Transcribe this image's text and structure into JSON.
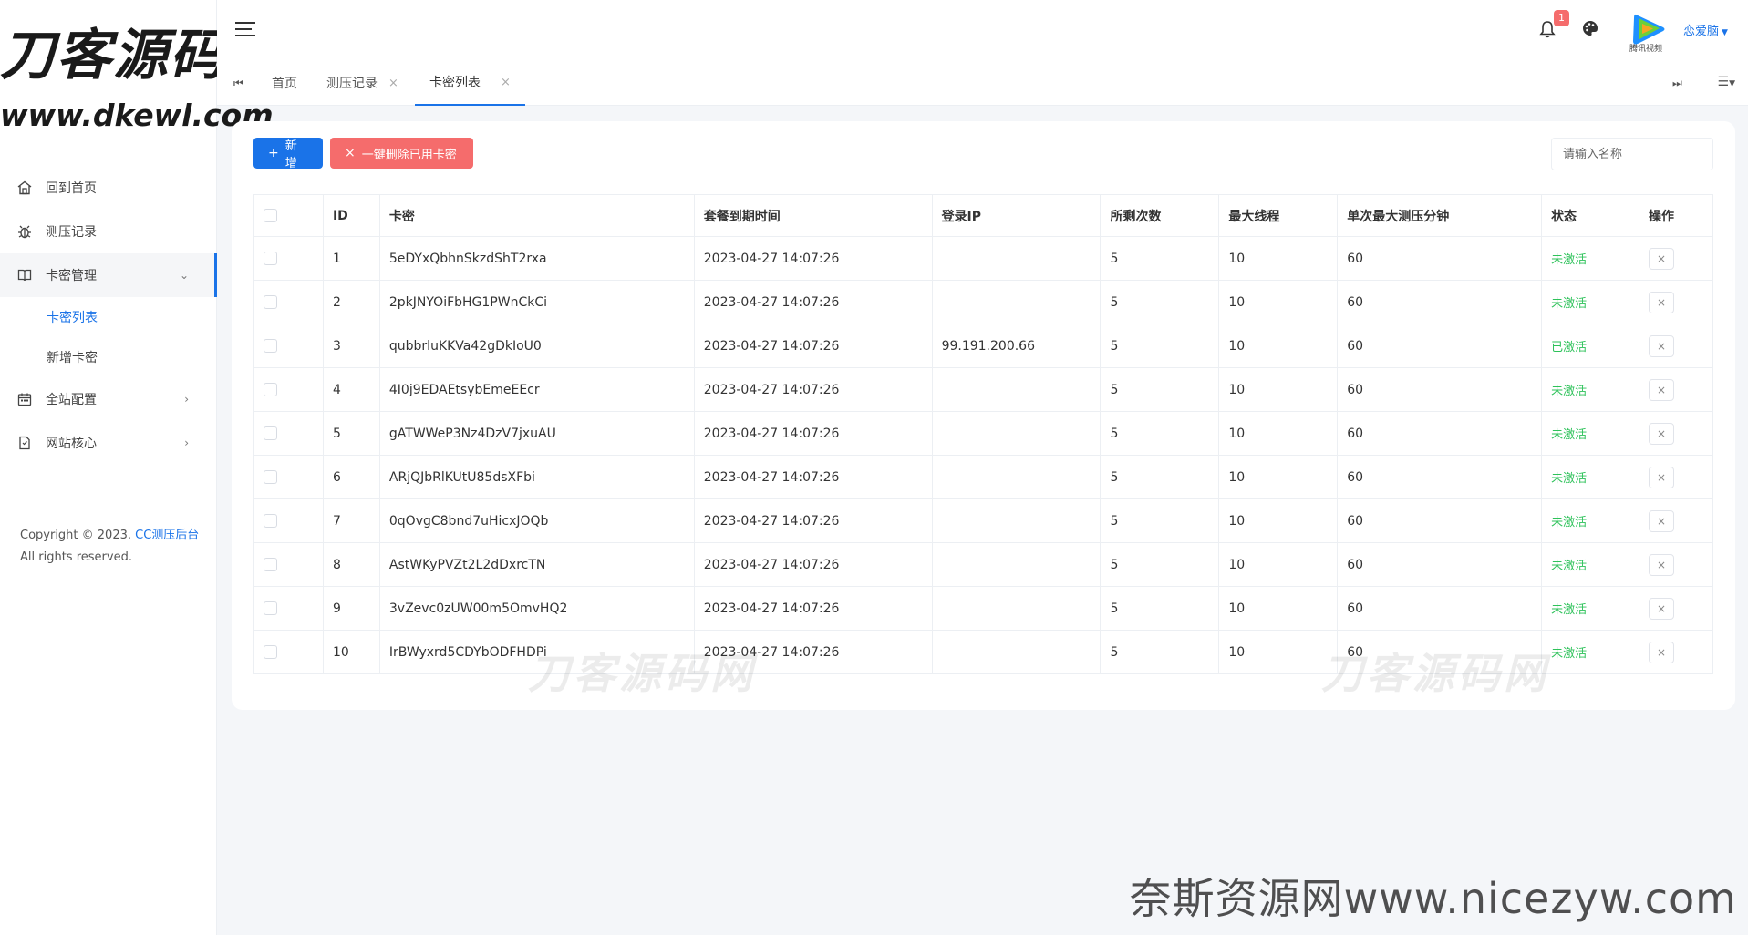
{
  "logo": {
    "title": "刀客源码网",
    "subtitle": "www.dkewl.com"
  },
  "sidebar": {
    "items": [
      {
        "label": "回到首页",
        "icon": "home-icon"
      },
      {
        "label": "测压记录",
        "icon": "bug-icon"
      },
      {
        "label": "卡密管理",
        "icon": "book-icon",
        "open": true,
        "children": [
          {
            "label": "卡密列表",
            "active": true
          },
          {
            "label": "新增卡密"
          }
        ]
      },
      {
        "label": "全站配置",
        "icon": "calendar-icon"
      },
      {
        "label": "网站核心",
        "icon": "file-icon"
      }
    ],
    "copyright_prefix": "Copyright © 2023. ",
    "copyright_link": "CC测压后台",
    "copyright_rights": "All rights reserved."
  },
  "header": {
    "notification_count": "1",
    "avatar_caption": "腾讯视频",
    "username": "恋爱脑"
  },
  "tabs": [
    {
      "label": "首页",
      "closable": false
    },
    {
      "label": "测压记录",
      "closable": true
    },
    {
      "label": "卡密列表",
      "closable": true,
      "active": true
    }
  ],
  "toolbar": {
    "add_label": "新增",
    "delete_used_label": "一键删除已用卡密",
    "search_placeholder": "请输入名称"
  },
  "table": {
    "columns": [
      "ID",
      "卡密",
      "套餐到期时间",
      "登录IP",
      "所剩次数",
      "最大线程",
      "单次最大测压分钟",
      "状态",
      "操作"
    ],
    "rows": [
      {
        "id": "1",
        "card": "5eDYxQbhnSkzdShT2rxa",
        "expire": "2023-04-27 14:07:26",
        "ip": "",
        "remaining": "5",
        "threads": "10",
        "minutes": "60",
        "status": "未激活"
      },
      {
        "id": "2",
        "card": "2pkJNYOiFbHG1PWnCkCi",
        "expire": "2023-04-27 14:07:26",
        "ip": "",
        "remaining": "5",
        "threads": "10",
        "minutes": "60",
        "status": "未激活"
      },
      {
        "id": "3",
        "card": "qubbrluKKVa42gDkIoU0",
        "expire": "2023-04-27 14:07:26",
        "ip": "99.191.200.66",
        "remaining": "5",
        "threads": "10",
        "minutes": "60",
        "status": "已激活"
      },
      {
        "id": "4",
        "card": "4I0j9EDAEtsybEmeEEcr",
        "expire": "2023-04-27 14:07:26",
        "ip": "",
        "remaining": "5",
        "threads": "10",
        "minutes": "60",
        "status": "未激活"
      },
      {
        "id": "5",
        "card": "gATWWeP3Nz4DzV7jxuAU",
        "expire": "2023-04-27 14:07:26",
        "ip": "",
        "remaining": "5",
        "threads": "10",
        "minutes": "60",
        "status": "未激活"
      },
      {
        "id": "6",
        "card": "ARjQJbRlKUtU85dsXFbi",
        "expire": "2023-04-27 14:07:26",
        "ip": "",
        "remaining": "5",
        "threads": "10",
        "minutes": "60",
        "status": "未激活"
      },
      {
        "id": "7",
        "card": "0qOvgC8bnd7uHicxJOQb",
        "expire": "2023-04-27 14:07:26",
        "ip": "",
        "remaining": "5",
        "threads": "10",
        "minutes": "60",
        "status": "未激活"
      },
      {
        "id": "8",
        "card": "AstWKyPVZt2L2dDxrcTN",
        "expire": "2023-04-27 14:07:26",
        "ip": "",
        "remaining": "5",
        "threads": "10",
        "minutes": "60",
        "status": "未激活"
      },
      {
        "id": "9",
        "card": "3vZevc0zUW00m5OmvHQ2",
        "expire": "2023-04-27 14:07:26",
        "ip": "",
        "remaining": "5",
        "threads": "10",
        "minutes": "60",
        "status": "未激活"
      },
      {
        "id": "10",
        "card": "IrBWyxrd5CDYbODFHDPi",
        "expire": "2023-04-27 14:07:26",
        "ip": "",
        "remaining": "5",
        "threads": "10",
        "minutes": "60",
        "status": "未激活"
      }
    ]
  },
  "watermarks": {
    "table_mark": "刀客源码网",
    "corner": "奈斯资源网www.nicezyw.com"
  },
  "colors": {
    "primary": "#1a73e8",
    "danger": "#f56c6c",
    "success": "#2ec25a"
  }
}
